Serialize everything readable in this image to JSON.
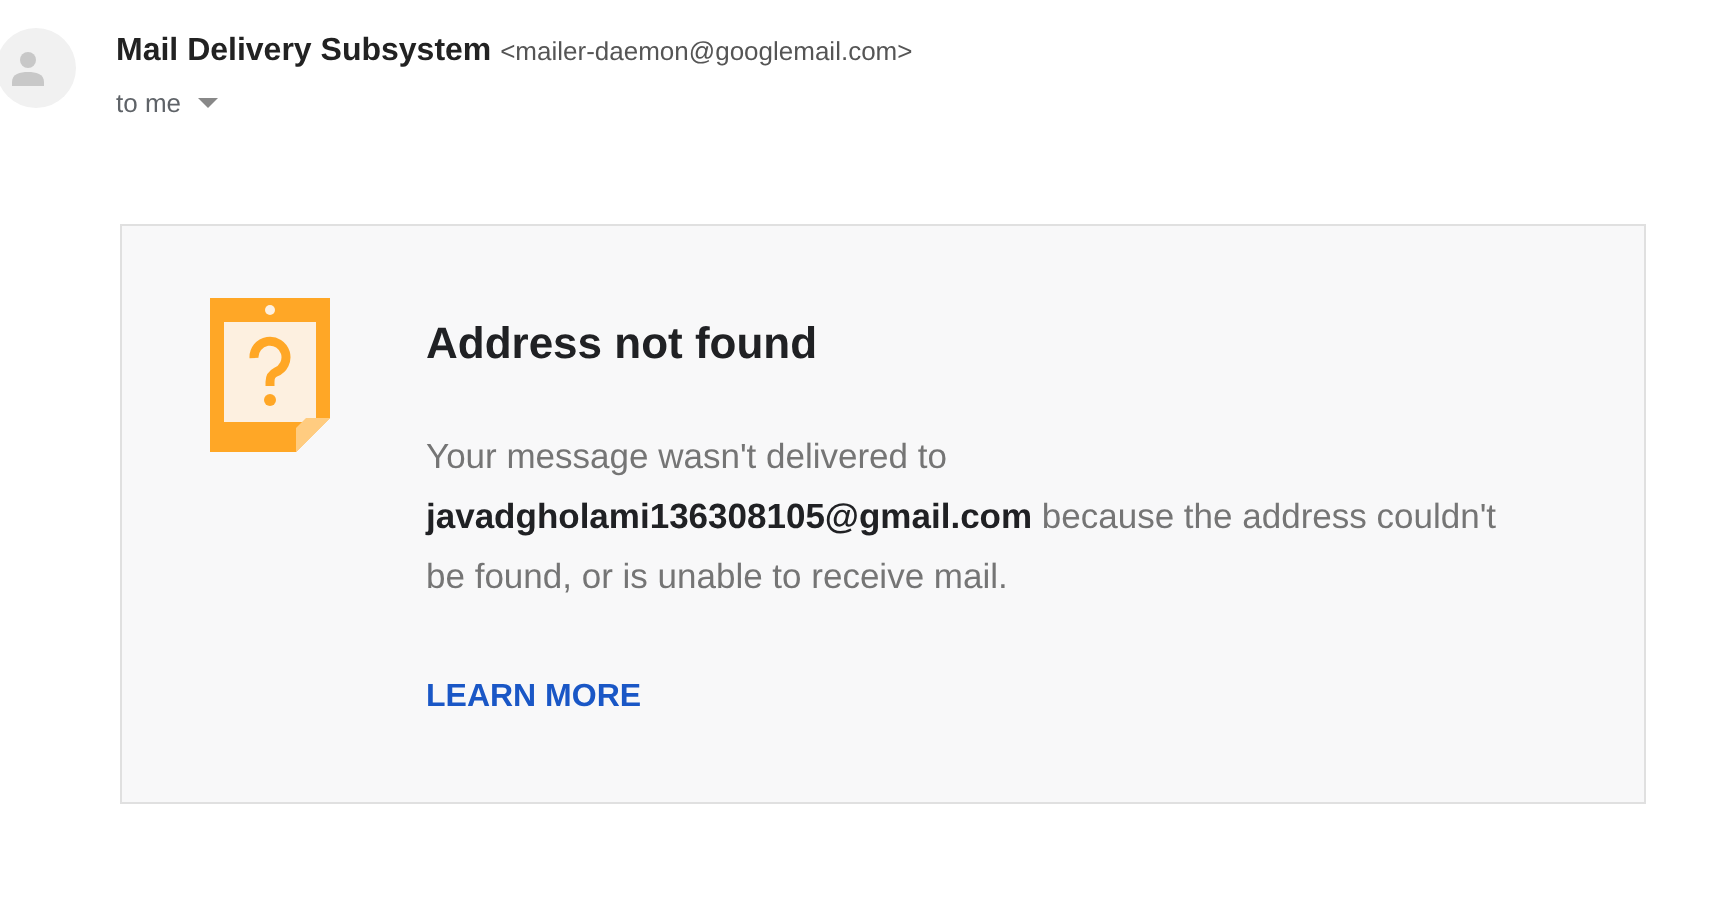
{
  "sender": {
    "name": "Mail Delivery Subsystem",
    "address": "<mailer-daemon@googlemail.com>",
    "recipient": "to me"
  },
  "notice": {
    "title": "Address not found",
    "message": "Your message wasn't delivered to **javadgholami136308105@gmail.com** because the address couldn't be found, or is unable to receive mail.",
    "link": "LEARN MORE"
  }
}
